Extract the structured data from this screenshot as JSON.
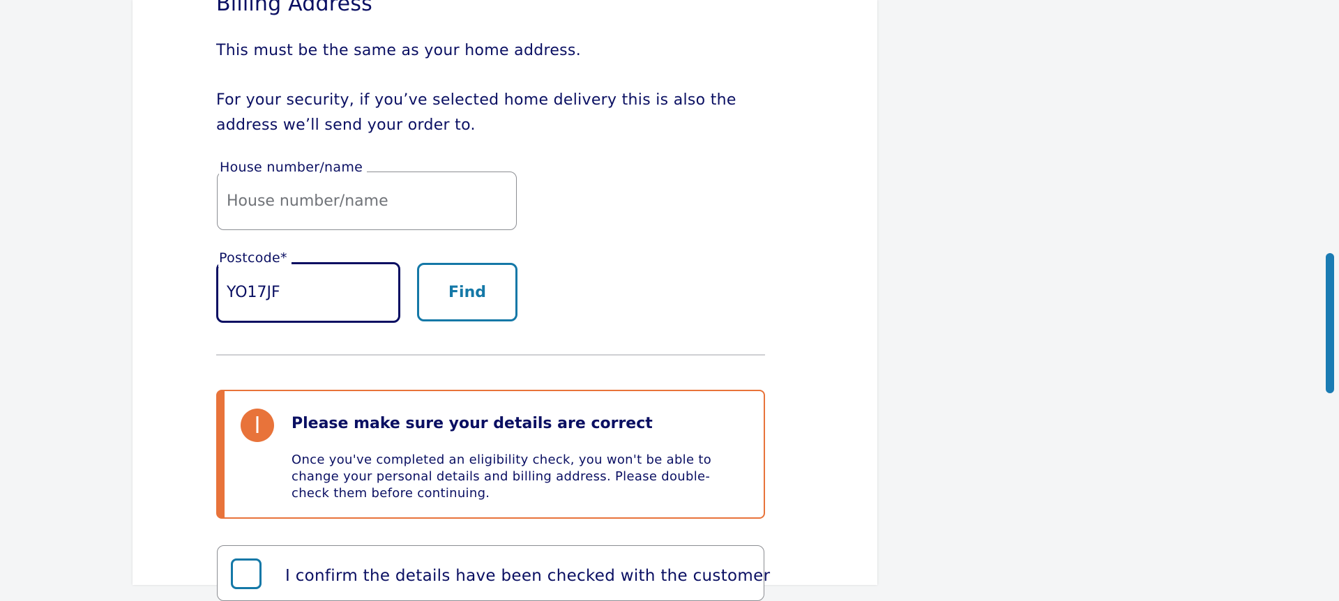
{
  "section": {
    "heading": "Billing Address",
    "intro_1": "This must be the same as your home address.",
    "intro_2": "For your security, if you’ve selected home delivery this is also the address we’ll send your order to."
  },
  "house_field": {
    "label": "House number/name",
    "placeholder": "House number/name",
    "value": ""
  },
  "postcode_field": {
    "label": "Postcode*",
    "value": "YO17JF"
  },
  "find_button": {
    "label": "Find"
  },
  "notice": {
    "title": "Please make sure your details are correct",
    "body": "Once you've completed an eligibility check, you won't be able to change your personal details and billing address. Please double-check them before continuing.",
    "icon": "info-icon",
    "accent_color": "#e8733a"
  },
  "confirmation": {
    "label": "I confirm the details have been checked with the customer",
    "checked": false
  },
  "colors": {
    "text": "#0a0f62",
    "link_blue": "#1478a7",
    "page_bg": "#f4f5f6"
  }
}
